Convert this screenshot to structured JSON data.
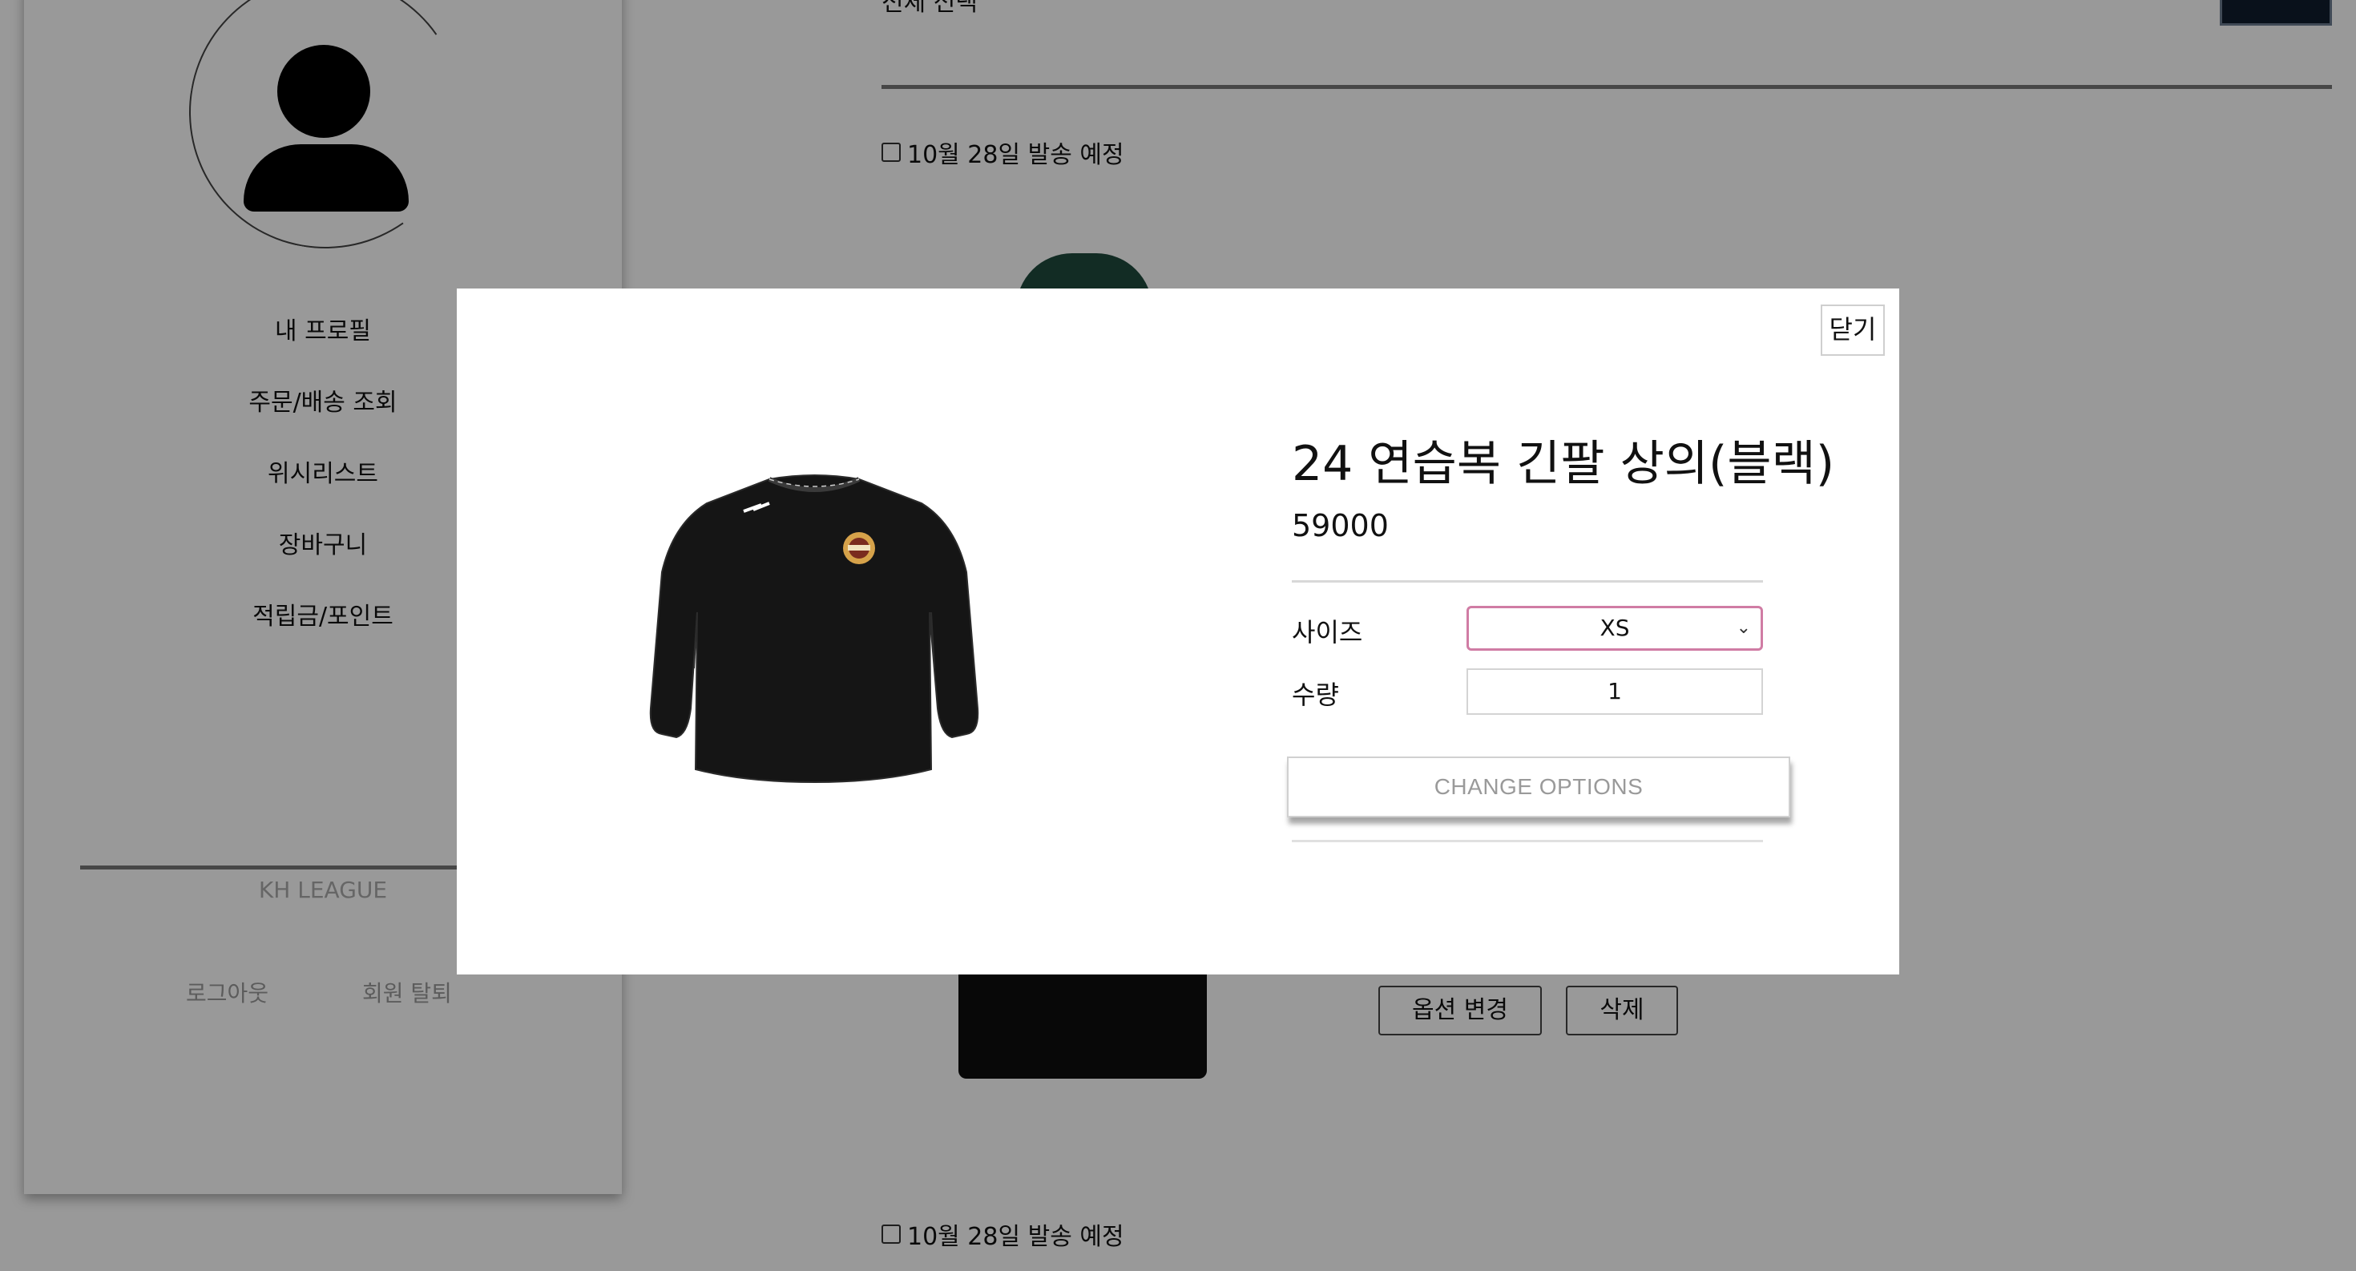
{
  "sidebar": {
    "menu": [
      {
        "label": "내 프로필"
      },
      {
        "label": "주문/배송 조회"
      },
      {
        "label": "위시리스트"
      },
      {
        "label": "장바구니"
      },
      {
        "label": "적립금/포인트"
      }
    ],
    "brand": "KH LEAGUE",
    "logout_label": "로그아웃",
    "withdraw_label": "회원 탈퇴"
  },
  "orders": {
    "top_partial_text": "전체 선택",
    "ship_notice_1": "10월 28일 발송 예정",
    "ship_notice_2": "10월 28일 발송 예정",
    "change_option_label": "옵션 변경",
    "delete_label": "삭제"
  },
  "modal": {
    "close_label": "닫기",
    "product_title": "24 연습복 긴팔 상의(블랙)",
    "price": "59000",
    "size_label": "사이즈",
    "size_value": "XS",
    "quantity_label": "수량",
    "quantity_value": "1",
    "change_options_label": "CHANGE OPTIONS"
  },
  "colors": {
    "overlay": "#000000",
    "select_border": "#d07ca4",
    "dark_button": "#0f1d2e"
  }
}
